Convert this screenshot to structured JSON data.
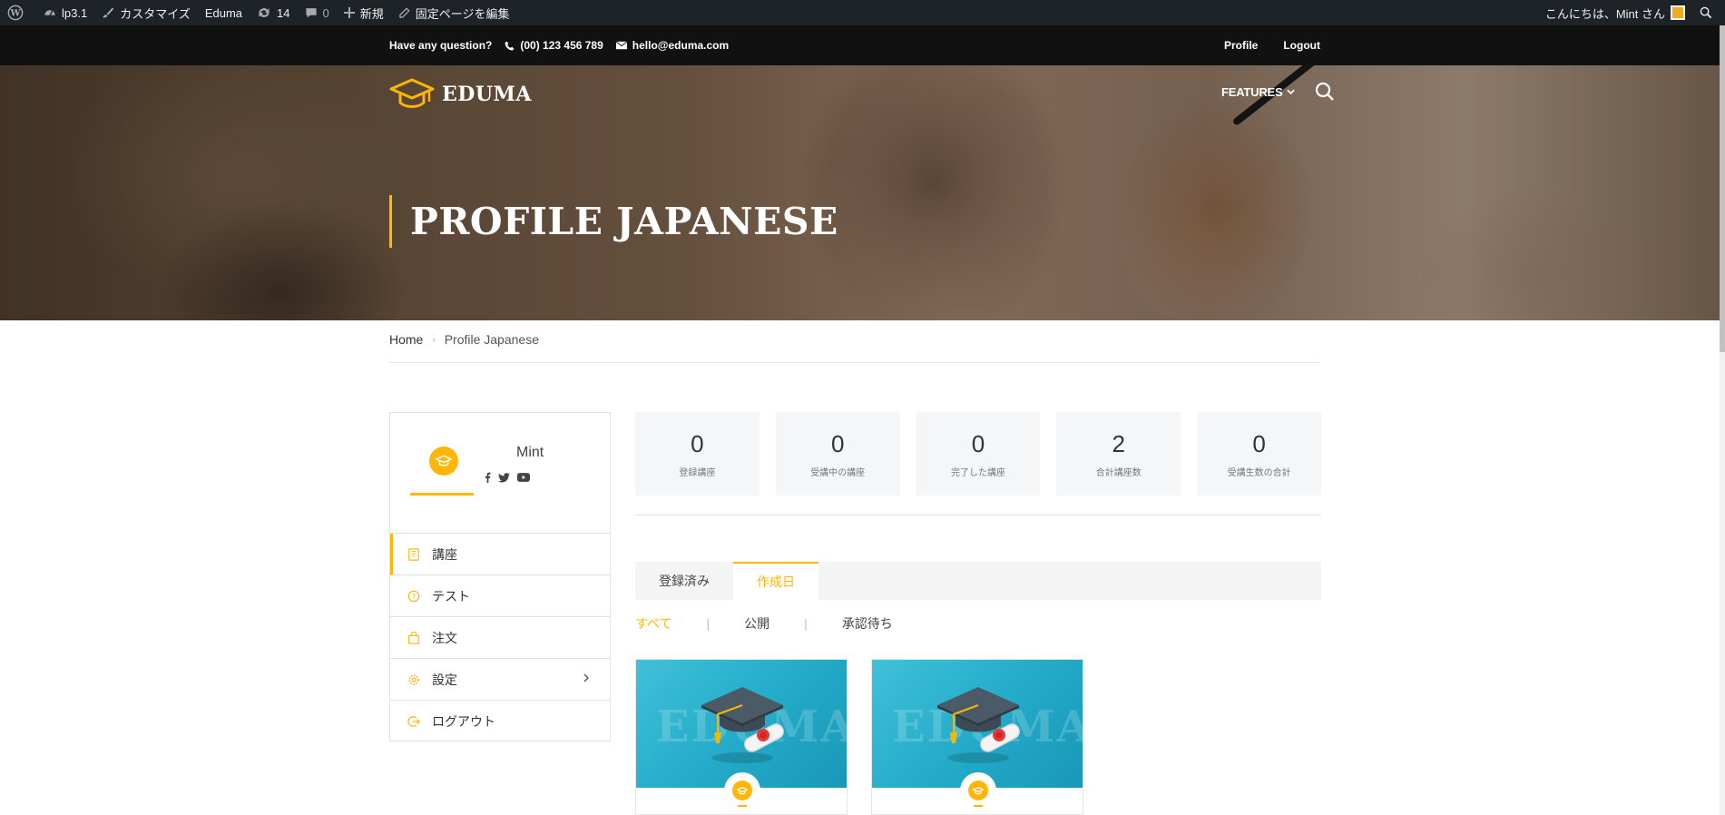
{
  "admin_bar": {
    "site_name": "lp3.1",
    "customize": "カスタマイズ",
    "theme": "Eduma",
    "updates_count": "14",
    "comments_count": "0",
    "new_label": "新規",
    "edit_page": "固定ページを編集",
    "greeting": "こんにちは、Mint さん"
  },
  "top_bar": {
    "question": "Have any question?",
    "phone": "(00) 123 456 789",
    "email": "hello@eduma.com",
    "profile_link": "Profile",
    "logout_link": "Logout"
  },
  "header": {
    "logo_text": "EDUMA",
    "nav_features": "FEATURES",
    "page_title": "PROFILE JAPANESE"
  },
  "breadcrumb": {
    "home": "Home",
    "current": "Profile Japanese"
  },
  "profile": {
    "username": "Mint"
  },
  "sidebar": {
    "items": [
      {
        "label": "講座"
      },
      {
        "label": "テスト"
      },
      {
        "label": "注文"
      },
      {
        "label": "設定"
      },
      {
        "label": "ログアウト"
      }
    ]
  },
  "stats": [
    {
      "value": "0",
      "label": "登録講座"
    },
    {
      "value": "0",
      "label": "受講中の講座"
    },
    {
      "value": "0",
      "label": "完了した講座"
    },
    {
      "value": "2",
      "label": "合計講座数"
    },
    {
      "value": "0",
      "label": "受講生数の合計"
    }
  ],
  "tabs": [
    {
      "label": "登録済み"
    },
    {
      "label": "作成日"
    }
  ],
  "filters": [
    {
      "label": "すべて"
    },
    {
      "label": "公開"
    },
    {
      "label": "承認待ち"
    }
  ],
  "courses": [
    {
      "watermark": "EDUMA"
    },
    {
      "watermark": "EDUMA"
    }
  ],
  "colors": {
    "accent": "#ffb606",
    "admin_bar": "#1d2327",
    "top_bar": "#111111"
  }
}
